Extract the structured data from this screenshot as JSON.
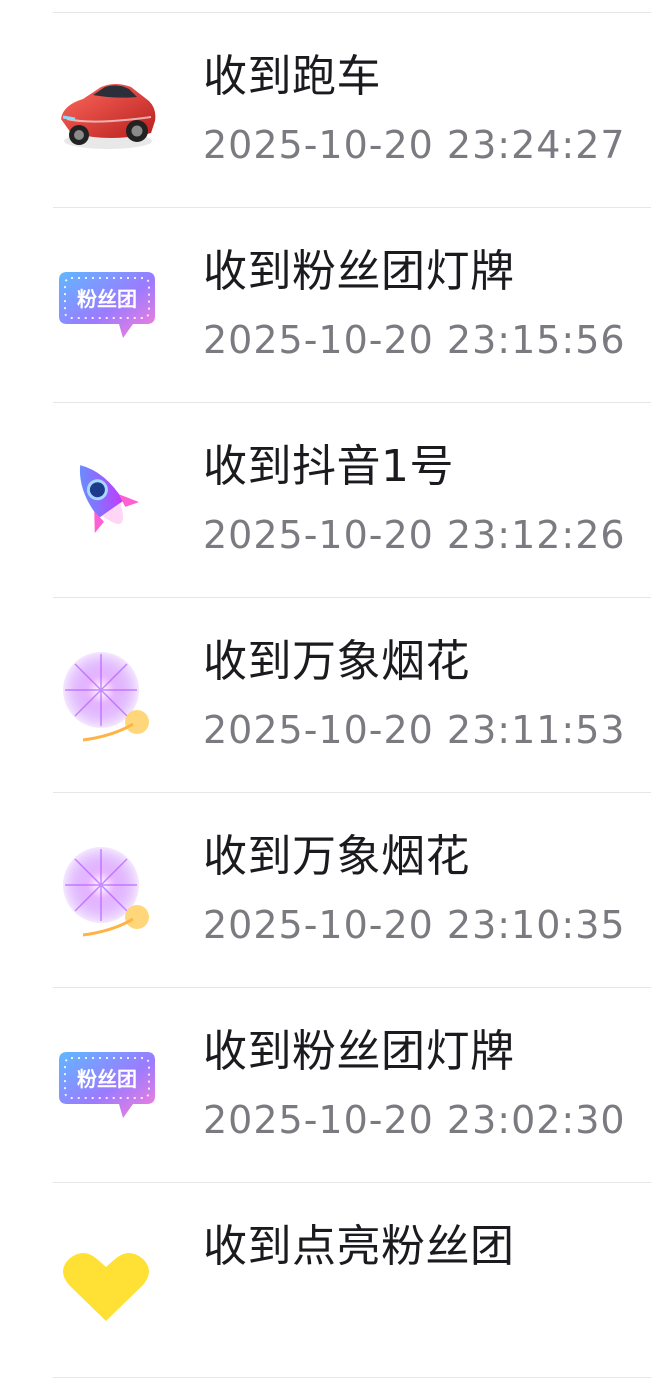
{
  "records": [
    {
      "title": "收到跑车",
      "time": "2025-10-20 23:24:27",
      "icon": "sports-car-icon"
    },
    {
      "title": "收到粉丝团灯牌",
      "time": "2025-10-20 23:15:56",
      "icon": "fan-club-badge-icon",
      "badge_text": "粉丝团"
    },
    {
      "title": "收到抖音1号",
      "time": "2025-10-20 23:12:26",
      "icon": "rocket-icon"
    },
    {
      "title": "收到万象烟花",
      "time": "2025-10-20 23:11:53",
      "icon": "fireworks-icon"
    },
    {
      "title": "收到万象烟花",
      "time": "2025-10-20 23:10:35",
      "icon": "fireworks-icon"
    },
    {
      "title": "收到粉丝团灯牌",
      "time": "2025-10-20 23:02:30",
      "icon": "fan-club-badge-icon",
      "badge_text": "粉丝团"
    },
    {
      "title": "收到点亮粉丝团",
      "time": "",
      "icon": "heart-icon"
    }
  ],
  "colors": {
    "title": "#1b1b1f",
    "time": "#7a7a80",
    "divider": "#e6e6e8"
  }
}
